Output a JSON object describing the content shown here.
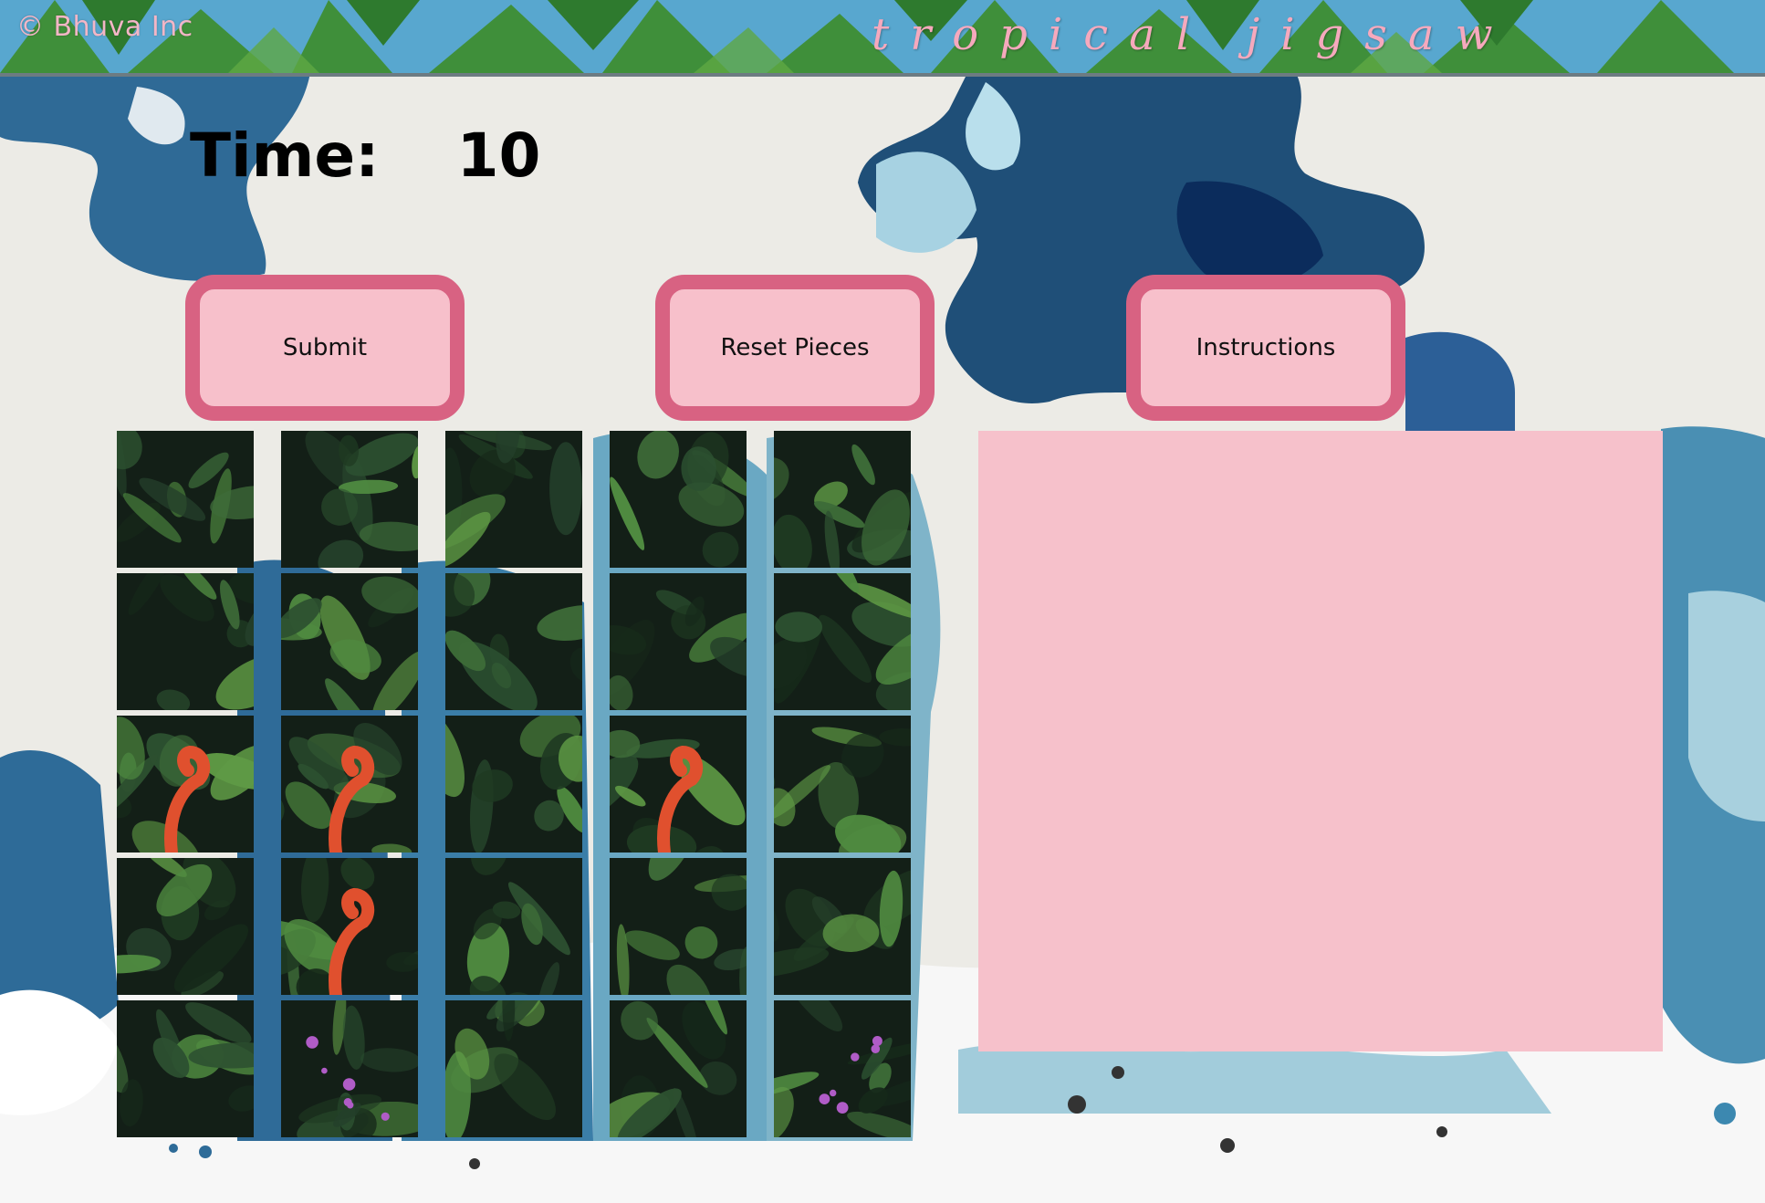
{
  "header": {
    "copyright": "© Bhuva Inc",
    "title": "tropical jigsaw"
  },
  "timer": {
    "label": "Time:",
    "value": "10"
  },
  "buttons": {
    "submit": "Submit",
    "reset": "Reset Pieces",
    "instructions": "Instructions"
  },
  "colors": {
    "button_fill": "#f7c0cb",
    "button_border": "#d86282",
    "board_fill": "#f6c1cb",
    "title_pink": "#f6a9bd"
  },
  "pieces": {
    "rows": 5,
    "cols": 5,
    "images": [
      "leaf-cluster",
      "branch-leaves",
      "vine-leaves",
      "foliage",
      "large-leaf",
      "dark-foliage",
      "hanging-leaves",
      "dark-leaves",
      "bright-leaves",
      "shadow-leaves",
      "flamingo-leaves",
      "flamingo-neck",
      "pale-leaves",
      "ibis-head",
      "green-leaves",
      "ferns",
      "flamingo-body",
      "branches",
      "shadow-branches",
      "dark-vines",
      "broad-leaf",
      "purple-flowers",
      "twigs",
      "branch-perch",
      "purple-buds"
    ]
  }
}
